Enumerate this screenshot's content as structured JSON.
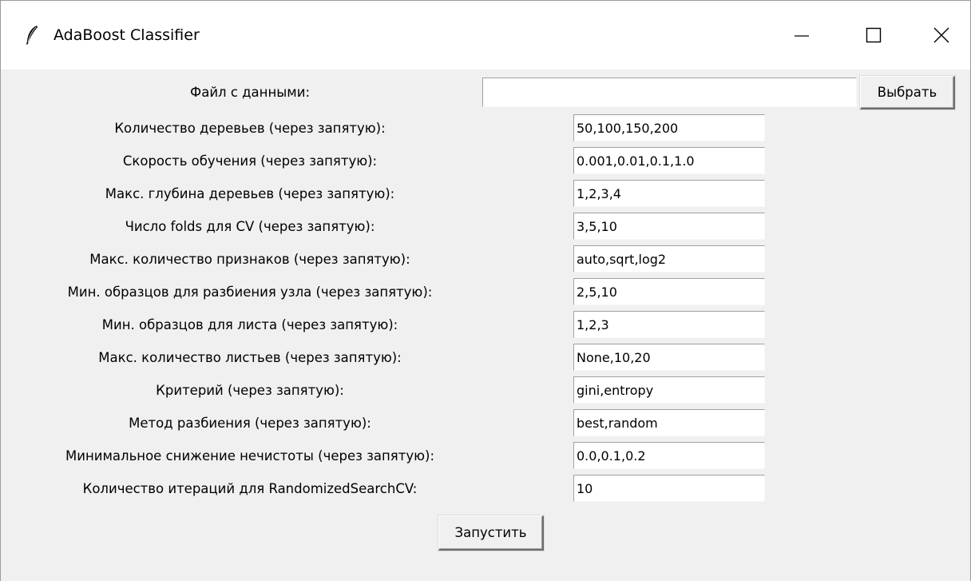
{
  "window": {
    "title": "AdaBoost Classifier",
    "icon": "feather-icon",
    "controls": [
      "minimize-icon",
      "maximize-icon",
      "close-icon"
    ]
  },
  "file": {
    "label": "Файл с данными:",
    "value": "",
    "browse_label": "Выбрать"
  },
  "fields": [
    {
      "label": "Количество деревьев (через запятую):",
      "value": "50,100,150,200"
    },
    {
      "label": "Скорость обучения (через запятую):",
      "value": "0.001,0.01,0.1,1.0"
    },
    {
      "label": "Макс. глубина деревьев (через запятую):",
      "value": "1,2,3,4"
    },
    {
      "label": "Число folds для CV (через запятую):",
      "value": "3,5,10"
    },
    {
      "label": "Макс. количество признаков (через запятую):",
      "value": "auto,sqrt,log2"
    },
    {
      "label": "Мин. образцов для разбиения узла (через запятую):",
      "value": "2,5,10"
    },
    {
      "label": "Мин. образцов для листа (через запятую):",
      "value": "1,2,3"
    },
    {
      "label": "Макс. количество листьев (через запятую):",
      "value": "None,10,20"
    },
    {
      "label": "Критерий (через запятую):",
      "value": "gini,entropy"
    },
    {
      "label": "Метод разбиения (через запятую):",
      "value": "best,random"
    },
    {
      "label": "Минимальное снижение нечистоты (через запятую):",
      "value": "0.0,0.1,0.2"
    },
    {
      "label": "Количество итераций для RandomizedSearchCV:",
      "value": "10"
    }
  ],
  "run_label": "Запустить"
}
